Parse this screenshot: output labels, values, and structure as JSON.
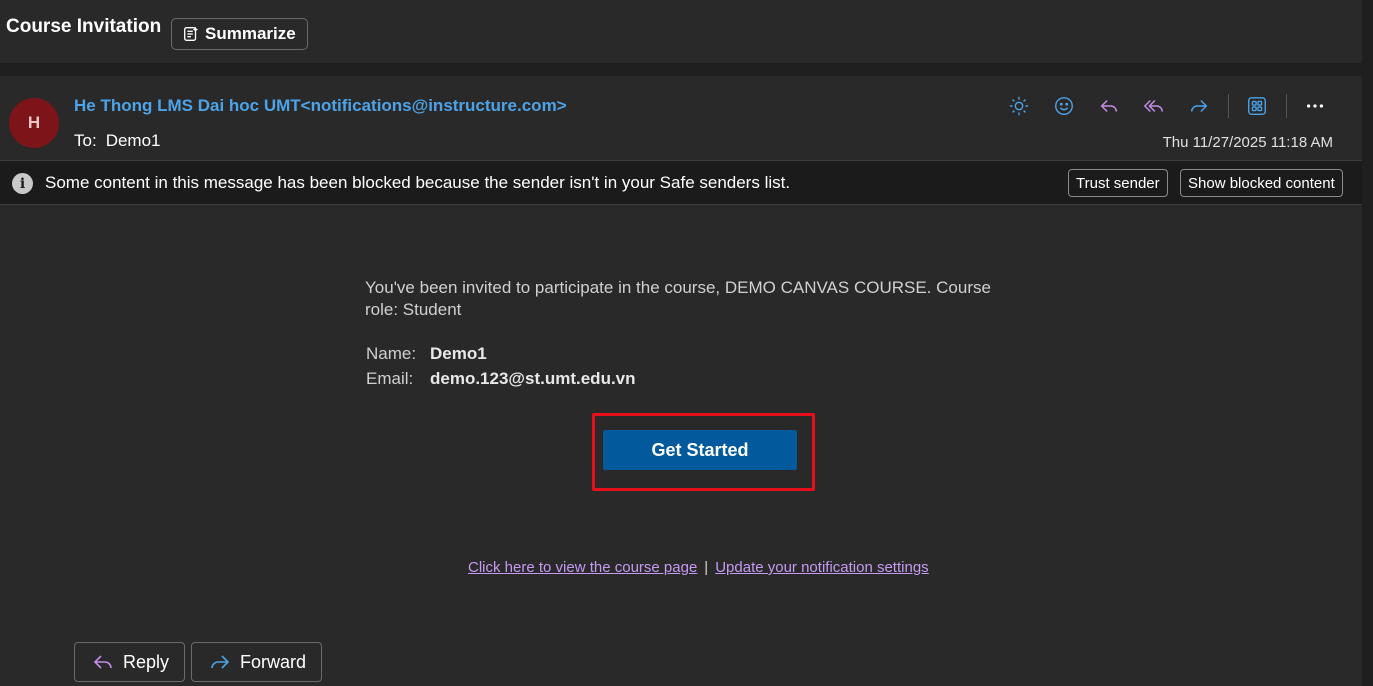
{
  "header": {
    "subject": "Course Invitation",
    "summarize_label": "Summarize"
  },
  "message": {
    "avatar_initial": "H",
    "sender": "He Thong LMS Dai hoc UMT<notifications@instructure.com>",
    "to_label": "To:",
    "to_value": "Demo1",
    "date": "Thu 11/27/2025 11:18 AM"
  },
  "actions": {
    "icons": [
      "sun-icon",
      "emoji-icon",
      "reply-icon",
      "reply-all-icon",
      "forward-icon",
      "apps-icon",
      "more-icon"
    ]
  },
  "blocked_banner": {
    "text": "Some content in this message has been blocked because the sender isn't in your Safe senders list.",
    "trust_label": "Trust sender",
    "show_label": "Show blocked content"
  },
  "content": {
    "invite_text": "You've been invited to participate in the course, DEMO CANVAS COURSE. Course role: Student",
    "name_label": "Name:",
    "name_value": "Demo1",
    "email_label": "Email:",
    "email_value": "demo.123@st.umt.edu.vn",
    "cta_label": "Get Started",
    "link_course": "Click here to view the course page ",
    "link_separator": "|",
    "link_notifications": "Update your notification settings"
  },
  "footer": {
    "reply_label": "Reply",
    "forward_label": "Forward"
  },
  "colors": {
    "accent": "#4da3e8",
    "cta": "#025a9c",
    "highlight": "#e5101c",
    "link": "#c79af2",
    "reply_icon": "#c88be8"
  }
}
